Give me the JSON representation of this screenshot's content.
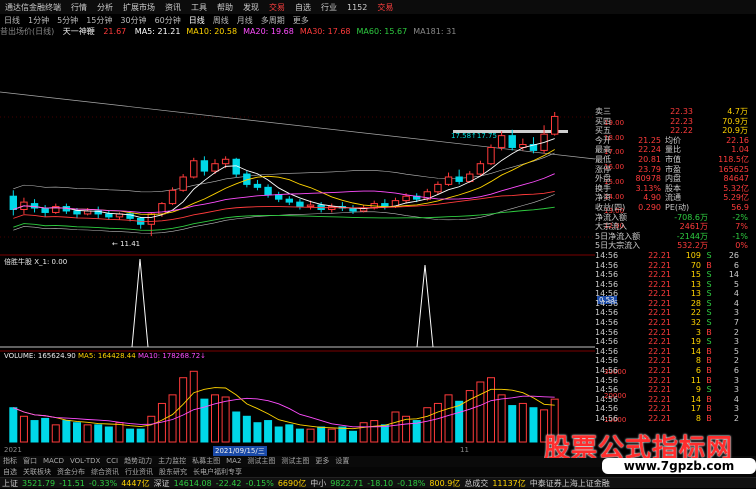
{
  "topbar": {
    "items": [
      "通达信金融终端",
      "行情",
      "分析",
      "扩展市场",
      "资讯",
      "工具",
      "帮助",
      "发现",
      "交易",
      "自选",
      "行业",
      "1152",
      "交易"
    ]
  },
  "tfbar": {
    "items": [
      "日线",
      "1分钟",
      "5分钟",
      "15分钟",
      "30分钟",
      "60分钟",
      "日线",
      "周线",
      "月线",
      "多周期",
      "更多"
    ]
  },
  "info": {
    "stock": "昔出场价(日线)",
    "name": "天一神鞭",
    "price": "21.67",
    "ma_labels": [
      {
        "text": "MA5: 21.21",
        "color": "#ffffff"
      },
      {
        "text": "MA10: 20.58",
        "color": "#ffd400"
      },
      {
        "text": "MA20: 19.68",
        "color": "#ff4dff"
      },
      {
        "text": "MA30: 17.68",
        "color": "#ff3b3b"
      },
      {
        "text": "MA60: 15.67",
        "color": "#2ecc40"
      },
      {
        "text": "MA181: 31",
        "color": "#888888"
      }
    ]
  },
  "chart_labels": {
    "price_marker": "17.58↑17.75",
    "low_marker": "← 11.41",
    "indicator_title": "倍胜牛股 X_1: 0.00",
    "indicator_value": "0.53",
    "volume_title": "VOLUME: 165624.90",
    "ma5_vol": "MA5: 164428.44",
    "ma10_vol": "MA10: 178268.72↓",
    "date_tag": "2021/09/15/三",
    "year_tag": "2021",
    "month_tag": "11",
    "y_axis_price": [
      "19.00",
      "18.00",
      "17.00",
      "16.00",
      "15.00",
      "14.00",
      "13.00",
      "12.00"
    ],
    "y_axis_vol": [
      "30000",
      "20000",
      "10000"
    ]
  },
  "quote": {
    "sell": [
      {
        "label": "卖三",
        "price": "22.33",
        "vol": "4.7万"
      },
      {
        "label": "买四",
        "price": "22.23",
        "vol": "70.9万"
      },
      {
        "label": "买五",
        "price": "22.22",
        "vol": "20.9万"
      }
    ],
    "stats": [
      {
        "k1": "今开",
        "v1": "21.25",
        "k2": "均价",
        "v2": "22.16"
      },
      {
        "k1": "最高",
        "v1": "22.24",
        "k2": "量比",
        "v2": "1.04"
      },
      {
        "k1": "最低",
        "v1": "20.81",
        "k2": "市值",
        "v2": "118.5亿"
      },
      {
        "k1": "涨停",
        "v1": "23.79",
        "k2": "市盈",
        "v2": "165625"
      },
      {
        "k1": "外盘",
        "v1": "80978",
        "k2": "内盘",
        "v2": "84647"
      },
      {
        "k1": "换手",
        "v1": "3.13%",
        "k2": "股本",
        "v2": "5.32亿"
      },
      {
        "k1": "净资",
        "v1": "4.90",
        "k2": "流通",
        "v2": "5.29亿"
      },
      {
        "k1": "收益(四)",
        "v1": "0.290",
        "k2": "PE(动)",
        "v2": "56.9"
      }
    ],
    "flows": [
      {
        "label": "净流入额",
        "val": "-708.6万",
        "pct": "-2%"
      },
      {
        "label": "大宗流入",
        "val": "2461万",
        "pct": "7%"
      },
      {
        "label": "5日净流入额",
        "val": "-2144万",
        "pct": "-1%"
      },
      {
        "label": "5日大宗流入",
        "val": "532.2万",
        "pct": "0%"
      }
    ],
    "ticks": [
      {
        "time": "14:56",
        "price": "22.21",
        "vol": "109",
        "flag": "S",
        "n": "26"
      },
      {
        "time": "14:56",
        "price": "22.21",
        "vol": "70",
        "flag": "B",
        "n": "6"
      },
      {
        "time": "14:56",
        "price": "22.21",
        "vol": "15",
        "flag": "S",
        "n": "14"
      },
      {
        "time": "14:56",
        "price": "22.21",
        "vol": "13",
        "flag": "S",
        "n": "5"
      },
      {
        "time": "14:56",
        "price": "22.21",
        "vol": "13",
        "flag": "S",
        "n": "4"
      },
      {
        "time": "14:56",
        "price": "22.21",
        "vol": "28",
        "flag": "S",
        "n": "4"
      },
      {
        "time": "14:56",
        "price": "22.21",
        "vol": "22",
        "flag": "S",
        "n": "3"
      },
      {
        "time": "14:56",
        "price": "22.21",
        "vol": "32",
        "flag": "S",
        "n": "7"
      },
      {
        "time": "14:56",
        "price": "22.21",
        "vol": "3",
        "flag": "B",
        "n": "2"
      },
      {
        "time": "14:56",
        "price": "22.21",
        "vol": "19",
        "flag": "S",
        "n": "3"
      },
      {
        "time": "14:56",
        "price": "22.21",
        "vol": "14",
        "flag": "B",
        "n": "5"
      },
      {
        "time": "14:56",
        "price": "22.21",
        "vol": "8",
        "flag": "B",
        "n": "2"
      },
      {
        "time": "14:56",
        "price": "22.21",
        "vol": "6",
        "flag": "B",
        "n": "6"
      },
      {
        "time": "14:56",
        "price": "22.21",
        "vol": "11",
        "flag": "B",
        "n": "3"
      },
      {
        "time": "14:56",
        "price": "22.21",
        "vol": "9",
        "flag": "S",
        "n": "3"
      },
      {
        "time": "14:56",
        "price": "22.21",
        "vol": "14",
        "flag": "B",
        "n": "4"
      },
      {
        "time": "14:56",
        "price": "22.21",
        "vol": "17",
        "flag": "B",
        "n": "3"
      },
      {
        "time": "14:56",
        "price": "22.21",
        "vol": "8",
        "flag": "B",
        "n": "2"
      }
    ]
  },
  "bottom_tabs1": [
    "指标",
    "窗口",
    "MACD",
    "VOL-TDX",
    "CCI",
    "趋势动力",
    "主力监控",
    "私募主图",
    "MA2",
    "测试主图",
    "测试主图",
    "更多",
    "设置"
  ],
  "bottom_tabs2": [
    "自选",
    "关联板块",
    "资金分布",
    "综合资讯",
    "行业资讯",
    "股东研究",
    "长电户福利专享"
  ],
  "status": [
    {
      "text": "上证",
      "color": "#cccccc"
    },
    {
      "text": "3521.79",
      "color": "#2ecc40"
    },
    {
      "text": "-11.51",
      "color": "#2ecc40"
    },
    {
      "text": "-0.33%",
      "color": "#2ecc40"
    },
    {
      "text": "4447亿",
      "color": "#ffd400"
    },
    {
      "text": "深证",
      "color": "#cccccc"
    },
    {
      "text": "14614.08",
      "color": "#2ecc40"
    },
    {
      "text": "-22.42",
      "color": "#2ecc40"
    },
    {
      "text": "-0.15%",
      "color": "#2ecc40"
    },
    {
      "text": "6690亿",
      "color": "#ffd400"
    },
    {
      "text": "中小",
      "color": "#cccccc"
    },
    {
      "text": "9822.71",
      "color": "#2ecc40"
    },
    {
      "text": "-18.10",
      "color": "#2ecc40"
    },
    {
      "text": "-0.18%",
      "color": "#2ecc40"
    },
    {
      "text": "800.9亿",
      "color": "#ffd400"
    },
    {
      "text": "总成交",
      "color": "#cccccc"
    },
    {
      "text": "11137亿",
      "color": "#ffd400"
    },
    {
      "text": "中泰证券上海上证金融",
      "color": "#cccccc"
    }
  ],
  "watermark": {
    "text1": "股票公式指标网",
    "text2": "www.7gpzb.com"
  },
  "chart_data": {
    "type": "candlestick",
    "candles": [
      {
        "o": 14.1,
        "c": 13.2,
        "h": 14.5,
        "l": 12.8
      },
      {
        "o": 13.2,
        "c": 13.7,
        "h": 14.0,
        "l": 12.9
      },
      {
        "o": 13.6,
        "c": 13.3,
        "h": 13.9,
        "l": 13.0
      },
      {
        "o": 13.3,
        "c": 13.0,
        "h": 13.5,
        "l": 12.7
      },
      {
        "o": 13.0,
        "c": 13.4,
        "h": 13.6,
        "l": 12.9
      },
      {
        "o": 13.4,
        "c": 13.1,
        "h": 13.6,
        "l": 12.9
      },
      {
        "o": 13.1,
        "c": 12.9,
        "h": 13.3,
        "l": 12.6
      },
      {
        "o": 12.9,
        "c": 13.1,
        "h": 13.3,
        "l": 12.8
      },
      {
        "o": 13.1,
        "c": 12.9,
        "h": 13.4,
        "l": 12.6
      },
      {
        "o": 12.9,
        "c": 12.7,
        "h": 13.1,
        "l": 12.5
      },
      {
        "o": 12.7,
        "c": 12.9,
        "h": 13.0,
        "l": 12.5
      },
      {
        "o": 12.9,
        "c": 12.6,
        "h": 13.1,
        "l": 12.4
      },
      {
        "o": 12.6,
        "c": 12.2,
        "h": 12.7,
        "l": 11.9
      },
      {
        "o": 12.2,
        "c": 12.9,
        "h": 13.0,
        "l": 11.4
      },
      {
        "o": 12.9,
        "c": 13.6,
        "h": 13.7,
        "l": 12.7
      },
      {
        "o": 13.6,
        "c": 14.5,
        "h": 14.7,
        "l": 13.5
      },
      {
        "o": 14.5,
        "c": 15.4,
        "h": 15.6,
        "l": 14.4
      },
      {
        "o": 15.4,
        "c": 16.5,
        "h": 16.7,
        "l": 15.3
      },
      {
        "o": 16.5,
        "c": 15.8,
        "h": 16.8,
        "l": 15.5
      },
      {
        "o": 15.8,
        "c": 16.3,
        "h": 16.6,
        "l": 15.6
      },
      {
        "o": 16.3,
        "c": 16.6,
        "h": 16.8,
        "l": 16.0
      },
      {
        "o": 16.6,
        "c": 15.6,
        "h": 16.7,
        "l": 15.4
      },
      {
        "o": 15.6,
        "c": 14.9,
        "h": 15.8,
        "l": 14.7
      },
      {
        "o": 14.9,
        "c": 14.7,
        "h": 15.2,
        "l": 14.5
      },
      {
        "o": 14.7,
        "c": 14.2,
        "h": 14.9,
        "l": 14.0
      },
      {
        "o": 14.2,
        "c": 13.9,
        "h": 14.4,
        "l": 13.7
      },
      {
        "o": 13.9,
        "c": 13.7,
        "h": 14.1,
        "l": 13.5
      },
      {
        "o": 13.7,
        "c": 13.4,
        "h": 13.9,
        "l": 13.2
      },
      {
        "o": 13.4,
        "c": 13.5,
        "h": 13.8,
        "l": 13.2
      },
      {
        "o": 13.5,
        "c": 13.2,
        "h": 13.7,
        "l": 13.0
      },
      {
        "o": 13.2,
        "c": 13.4,
        "h": 13.6,
        "l": 13.0
      },
      {
        "o": 13.4,
        "c": 13.3,
        "h": 13.7,
        "l": 13.1
      },
      {
        "o": 13.3,
        "c": 13.1,
        "h": 13.5,
        "l": 12.9
      },
      {
        "o": 13.1,
        "c": 13.3,
        "h": 13.5,
        "l": 13.0
      },
      {
        "o": 13.3,
        "c": 13.6,
        "h": 13.8,
        "l": 13.2
      },
      {
        "o": 13.6,
        "c": 13.4,
        "h": 13.9,
        "l": 13.2
      },
      {
        "o": 13.4,
        "c": 13.8,
        "h": 14.0,
        "l": 13.3
      },
      {
        "o": 13.8,
        "c": 14.1,
        "h": 14.3,
        "l": 13.6
      },
      {
        "o": 14.1,
        "c": 13.9,
        "h": 14.3,
        "l": 13.7
      },
      {
        "o": 13.9,
        "c": 14.4,
        "h": 14.6,
        "l": 13.8
      },
      {
        "o": 14.4,
        "c": 14.9,
        "h": 15.1,
        "l": 14.2
      },
      {
        "o": 14.9,
        "c": 15.4,
        "h": 15.7,
        "l": 14.8
      },
      {
        "o": 15.4,
        "c": 15.1,
        "h": 15.9,
        "l": 14.9
      },
      {
        "o": 15.1,
        "c": 15.6,
        "h": 15.8,
        "l": 15.0
      },
      {
        "o": 15.6,
        "c": 16.3,
        "h": 16.5,
        "l": 15.5
      },
      {
        "o": 16.3,
        "c": 17.4,
        "h": 17.6,
        "l": 16.2
      },
      {
        "o": 17.4,
        "c": 18.2,
        "h": 18.5,
        "l": 17.2
      },
      {
        "o": 18.2,
        "c": 17.4,
        "h": 18.6,
        "l": 17.2
      },
      {
        "o": 17.4,
        "c": 17.6,
        "h": 18.0,
        "l": 17.2
      },
      {
        "o": 17.6,
        "c": 17.2,
        "h": 18.1,
        "l": 17.0
      },
      {
        "o": 17.2,
        "c": 18.3,
        "h": 18.9,
        "l": 17.0
      },
      {
        "o": 18.3,
        "c": 19.5,
        "h": 19.8,
        "l": 18.2
      }
    ],
    "volume": [
      16,
      12,
      10,
      11,
      8,
      10,
      9,
      8,
      8,
      7,
      9,
      6,
      6,
      12,
      18,
      22,
      30,
      33,
      20,
      22,
      21,
      14,
      12,
      9,
      10,
      7,
      8,
      6,
      6,
      7,
      6,
      7,
      5,
      9,
      10,
      8,
      14,
      12,
      10,
      16,
      18,
      22,
      19,
      24,
      28,
      30,
      22,
      17,
      18,
      16,
      15,
      20
    ]
  }
}
